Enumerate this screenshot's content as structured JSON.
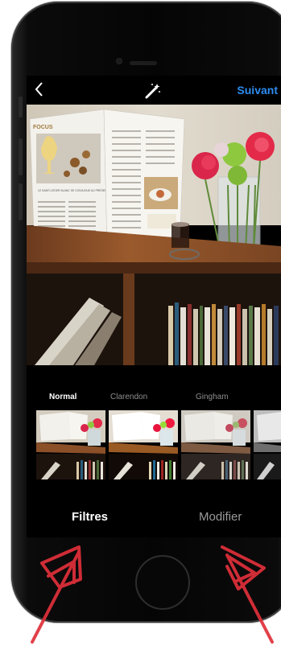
{
  "header": {
    "back_icon": "chevron-left-icon",
    "wand_icon": "magic-wand-icon",
    "next_label": "Suivant",
    "accent": "#2d8cf0"
  },
  "photo": {
    "magazine_section": "FOCUS",
    "article_title": "LE SAINT-LÉGER BLANC SE CONJUGUE AU PRÉSENT"
  },
  "filters": [
    {
      "label": "Normal",
      "active": true
    },
    {
      "label": "Clarendon",
      "active": false
    },
    {
      "label": "Gingham",
      "active": false
    }
  ],
  "tabs": {
    "filters_label": "Filtres",
    "edit_label": "Modifier"
  }
}
